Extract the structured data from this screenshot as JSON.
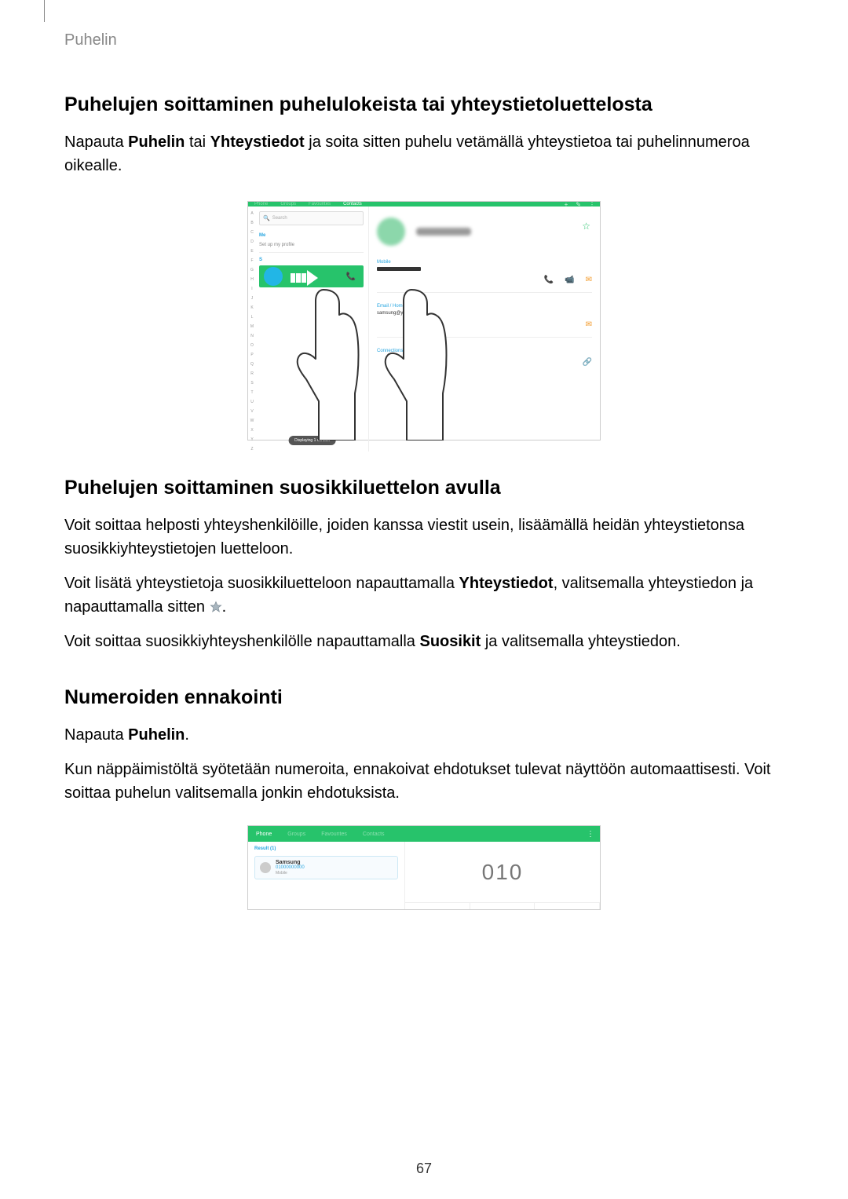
{
  "breadcrumb": "Puhelin",
  "page_number": "67",
  "sections": {
    "s1_title": "Puhelujen soittaminen puhelulokeista tai yhteystietoluettelosta",
    "s1_p1_a": "Napauta ",
    "s1_p1_b": "Puhelin",
    "s1_p1_c": " tai ",
    "s1_p1_d": "Yhteystiedot",
    "s1_p1_e": " ja soita sitten puhelu vetämällä yhteystietoa tai puhelinnumeroa oikealle.",
    "s2_title": "Puhelujen soittaminen suosikkiluettelon avulla",
    "s2_p1": "Voit soittaa helposti yhteyshenkilöille, joiden kanssa viestit usein, lisäämällä heidän yhteystietonsa suosikkiyhteystietojen luetteloon.",
    "s2_p2_a": "Voit lisätä yhteystietoja suosikkiluetteloon napauttamalla ",
    "s2_p2_b": "Yhteystiedot",
    "s2_p2_c": ", valitsemalla yhteystiedon ja napauttamalla sitten ",
    "s2_p2_d": ".",
    "s2_p3_a": "Voit soittaa suosikkiyhteyshenkilölle napauttamalla ",
    "s2_p3_b": "Suosikit",
    "s2_p3_c": " ja valitsemalla yhteystiedon.",
    "s3_title": "Numeroiden ennakointi",
    "s3_p1_a": "Napauta ",
    "s3_p1_b": "Puhelin",
    "s3_p1_c": ".",
    "s3_p2": "Kun näppäimistöltä syötetään numeroita, ennakoivat ehdotukset tulevat näyttöön automaattisesti. Voit soittaa puhelun valitsemalla jonkin ehdotuksista."
  },
  "fig1": {
    "tabs": [
      "Phone",
      "Groups",
      "Favourites",
      "Contacts"
    ],
    "icons": {
      "plus": "+",
      "edit": "✎",
      "more": "⋮"
    },
    "search_placeholder": "Search",
    "me_label": "Me",
    "setup_label": "Set up my profile",
    "letter": "S",
    "displaying": "Displaying 1 contact",
    "alpha": [
      "A",
      "B",
      "C",
      "D",
      "E",
      "F",
      "G",
      "H",
      "I",
      "J",
      "K",
      "L",
      "M",
      "N",
      "O",
      "P",
      "Q",
      "R",
      "S",
      "T",
      "U",
      "V",
      "W",
      "X",
      "Y",
      "Z"
    ],
    "detail_mobile_label": "Mobile",
    "detail_email_label": "Email / Home",
    "detail_email_value": "samsung@yahoo.com",
    "detail_connections_label": "Connections"
  },
  "fig2": {
    "tabs": [
      "Phone",
      "Groups",
      "Favourites",
      "Contacts"
    ],
    "result_count_label": "Result (1)",
    "card_name": "Samsung",
    "card_number": "01000000000",
    "card_type": "Mobile",
    "typed_number": "010"
  }
}
